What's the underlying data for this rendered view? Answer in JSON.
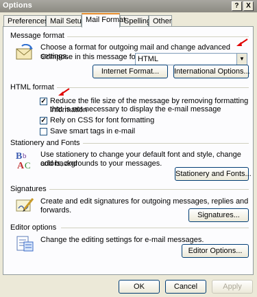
{
  "window": {
    "title": "Options",
    "help_btn": "?",
    "close_btn": "X"
  },
  "tabs": [
    {
      "label": "Preferences"
    },
    {
      "label": "Mail Setup"
    },
    {
      "label": "Mail Format"
    },
    {
      "label": "Spelling"
    },
    {
      "label": "Other"
    }
  ],
  "message_format": {
    "title": "Message format",
    "desc": "Choose a format for outgoing mail and change advanced settings.",
    "compose_label": "Compose in this message format:",
    "compose_value": "HTML",
    "internet_button": "Internet Format...",
    "international_button": "International Options..."
  },
  "html_format": {
    "title": "HTML format",
    "options": [
      {
        "label": "Reduce the file size of the message by removing formatting information",
        "label2": "that is not necessary to display the e-mail message",
        "checked": true
      },
      {
        "label": "Rely on CSS for font formatting",
        "checked": true
      },
      {
        "label": "Save smart tags in e-mail",
        "checked": false
      }
    ]
  },
  "stationery": {
    "title": "Stationery and Fonts",
    "desc1": "Use stationery to change your default font and style, change colors, and",
    "desc2": "add backgrounds to your messages.",
    "button": "Stationery and Fonts..."
  },
  "signatures": {
    "title": "Signatures",
    "desc": "Create and edit signatures for outgoing messages, replies and forwards.",
    "button": "Signatures..."
  },
  "editor": {
    "title": "Editor options",
    "desc": "Change the editing settings for e-mail messages.",
    "button": "Editor Options..."
  },
  "footer": {
    "ok": "OK",
    "cancel": "Cancel",
    "apply": "Apply"
  },
  "colors": {
    "accent_arrow": "#e00000",
    "tab_highlight": "#e68b2c"
  }
}
